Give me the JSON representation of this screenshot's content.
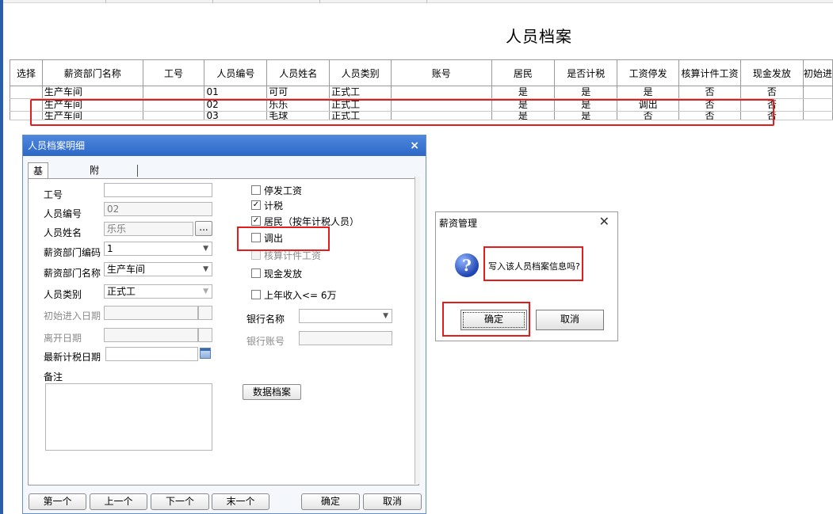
{
  "page": {
    "title": "人员档案"
  },
  "grid": {
    "columns": [
      "选择",
      "薪资部门名称",
      "工号",
      "人员编号",
      "人员姓名",
      "人员类别",
      "账号",
      "居民",
      "是否计税",
      "工资停发",
      "核算计件工资",
      "现金发放",
      "初始进"
    ],
    "rows": [
      [
        "",
        "生产车间",
        "",
        "01",
        "可可",
        "正式工",
        "",
        "是",
        "是",
        "是",
        "否",
        "否",
        ""
      ],
      [
        "",
        "生产车间",
        "",
        "02",
        "乐乐",
        "正式工",
        "",
        "是",
        "是",
        "调出",
        "否",
        "否",
        ""
      ],
      [
        "",
        "生产车间",
        "",
        "03",
        "毛球",
        "正式工",
        "",
        "是",
        "是",
        "否",
        "否",
        "否",
        ""
      ]
    ]
  },
  "detail": {
    "title": "人员档案明细",
    "tabs": [
      "基本信息",
      "附加信息"
    ],
    "labels": {
      "gonghao": "工号",
      "renyuan_bianhao": "人员编号",
      "renyuan_xingming": "人员姓名",
      "bumen_bianma": "薪资部门编码",
      "bumen_mingcheng": "薪资部门名称",
      "renyuan_leibie": "人员类别",
      "chushi_riqi": "初始进入日期",
      "likai_riqi": "离开日期",
      "zuixin_jishui": "最新计税日期",
      "beizhu": "备注",
      "yinhang_mingcheng": "银行名称",
      "yinhang_zhanghao": "银行账号"
    },
    "values": {
      "gonghao": "",
      "renyuan_bianhao": "02",
      "renyuan_xingming": "乐乐",
      "bumen_bianma": "1",
      "bumen_mingcheng": "生产车间",
      "renyuan_leibie": "正式工",
      "browse": "..."
    },
    "checks": {
      "tingfa": {
        "label": "停发工资",
        "checked": false
      },
      "jishui": {
        "label": "计税",
        "checked": true
      },
      "jumin": {
        "label": "居民（按年计税人员）",
        "checked": true
      },
      "diaochu": {
        "label": "调出",
        "checked": false
      },
      "jijian": {
        "label": "核算计件工资",
        "checked": false
      },
      "xianjin": {
        "label": "现金发放",
        "checked": false
      },
      "shangnian": {
        "label": "上年收入<= 6万",
        "checked": false
      }
    },
    "data_archive": "数据档案",
    "nav": [
      "第一个",
      "上一个",
      "下一个",
      "末一个"
    ],
    "ok": "确定",
    "cancel": "取消",
    "close": "×"
  },
  "message": {
    "title": "薪资管理",
    "text": "写入该人员档案信息吗?",
    "ok": "确定",
    "cancel": "取消",
    "close": "✕",
    "icon": "?"
  },
  "colors": {
    "titlebar": "#2e68c8",
    "highlight": "#e51c1c"
  }
}
